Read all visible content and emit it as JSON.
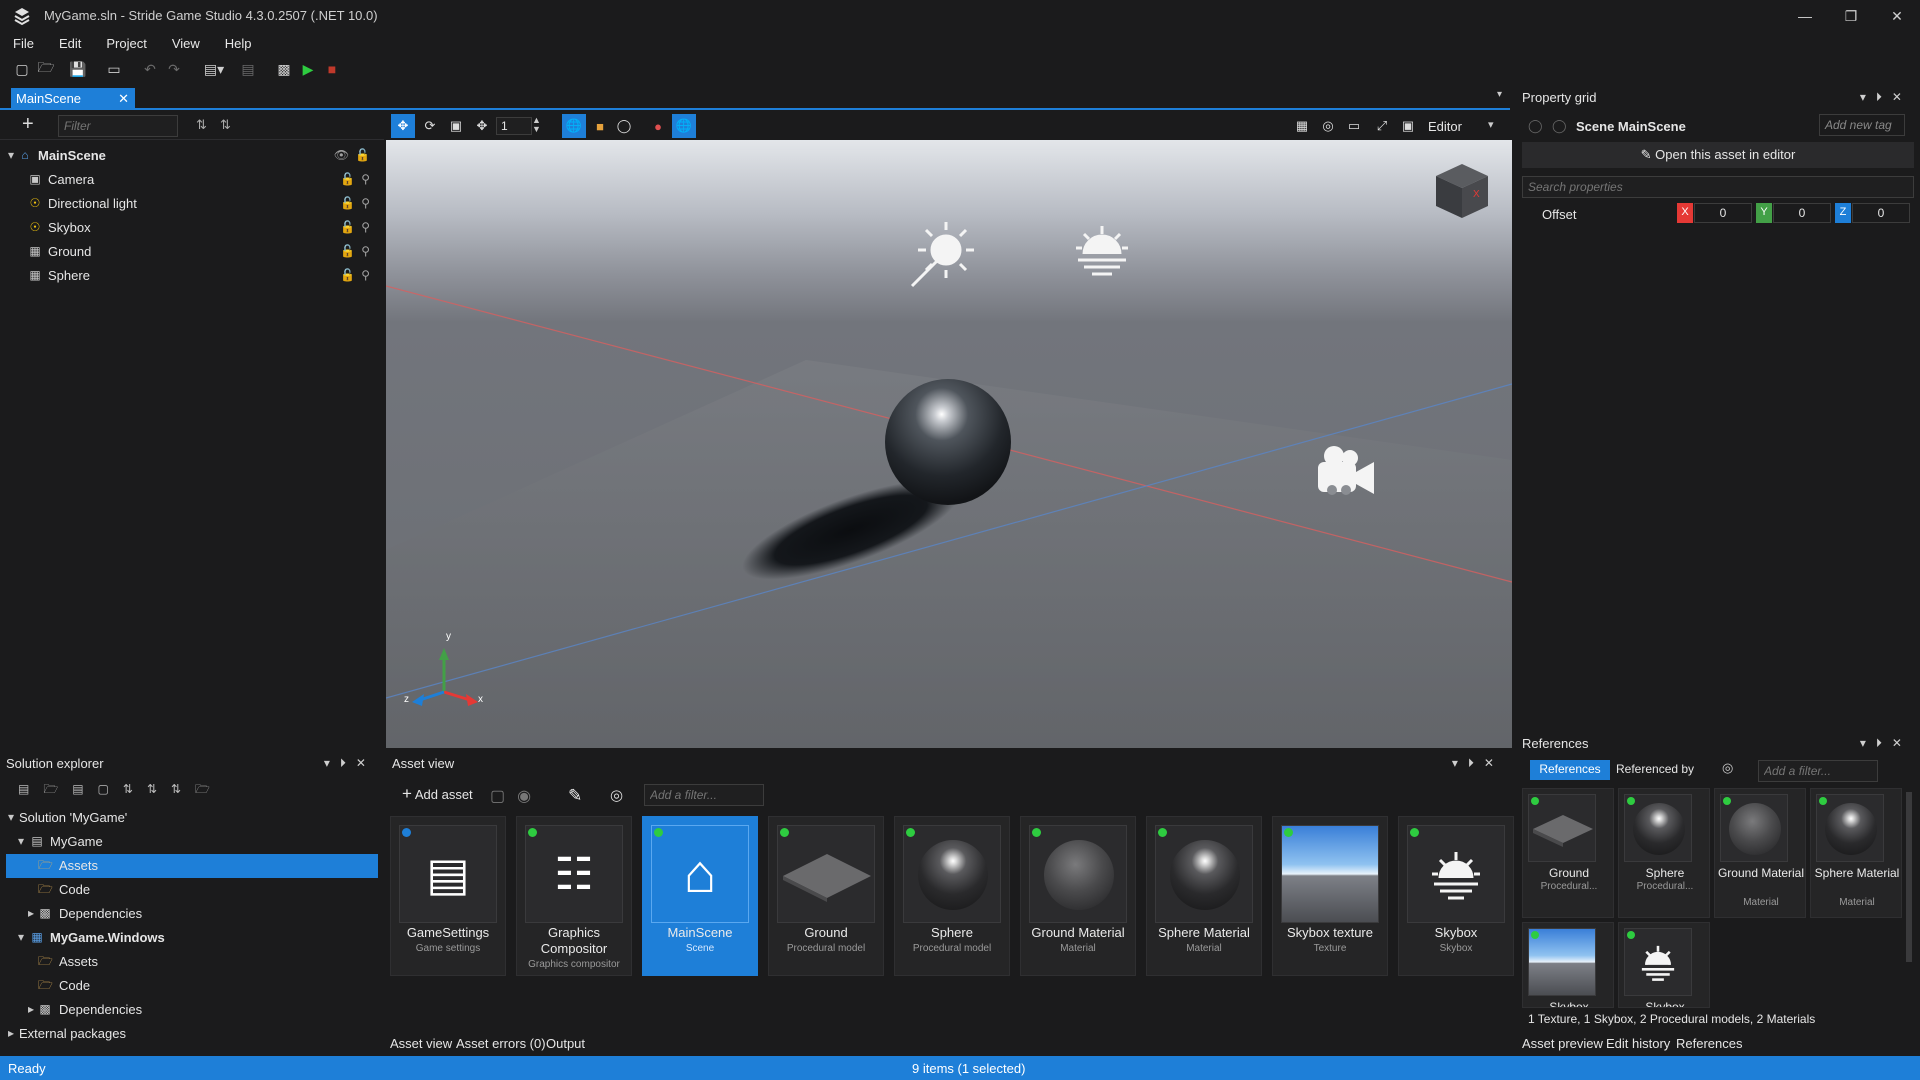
{
  "app": {
    "title": "MyGame.sln - Stride Game Studio 4.3.0.2507 (.NET 10.0)"
  },
  "menu": [
    "File",
    "Edit",
    "Project",
    "View",
    "Help"
  ],
  "document": {
    "tab": "MainScene"
  },
  "scene_tree": {
    "filter_placeholder": "Filter",
    "root": "MainScene",
    "entities": [
      "Camera",
      "Directional light",
      "Skybox",
      "Ground",
      "Sphere"
    ]
  },
  "viewport_toolbar": {
    "snap_value": "1",
    "mode": "Editor"
  },
  "gizmo": {
    "x": "x",
    "y": "y",
    "z": "z",
    "cube_x": "X"
  },
  "property_grid": {
    "title": "Property grid",
    "scene_label": "Scene MainScene",
    "add_tag": "Add new tag",
    "open_button": "Open this asset in editor",
    "search_placeholder": "Search properties",
    "offset": {
      "label": "Offset",
      "x_label": "X",
      "x": "0",
      "y_label": "Y",
      "y": "0",
      "z_label": "Z",
      "z": "0"
    }
  },
  "solution_explorer": {
    "title": "Solution explorer",
    "items": [
      {
        "label": "Solution 'MyGame'"
      },
      {
        "label": "MyGame"
      },
      {
        "label": "Assets"
      },
      {
        "label": "Code"
      },
      {
        "label": "Dependencies"
      },
      {
        "label": "MyGame.Windows"
      },
      {
        "label": "Assets"
      },
      {
        "label": "Code"
      },
      {
        "label": "Dependencies"
      },
      {
        "label": "External packages"
      }
    ]
  },
  "asset_view": {
    "title": "Asset view",
    "add_asset": "Add asset",
    "filter_placeholder": "Add a filter...",
    "assets": [
      {
        "name": "GameSettings",
        "type": "Game settings",
        "icon": "game-settings-icon"
      },
      {
        "name": "Graphics Compositor",
        "type": "Graphics compositor",
        "icon": "compositor-icon"
      },
      {
        "name": "MainScene",
        "type": "Scene",
        "icon": "scene-house-icon"
      },
      {
        "name": "Ground",
        "type": "Procedural model",
        "icon": "plane-thumbnail"
      },
      {
        "name": "Sphere",
        "type": "Procedural model",
        "icon": "sphere-thumbnail"
      },
      {
        "name": "Ground Material",
        "type": "Material",
        "icon": "material-thumbnail"
      },
      {
        "name": "Sphere Material",
        "type": "Material",
        "icon": "material-thumbnail"
      },
      {
        "name": "Skybox texture",
        "type": "Texture",
        "icon": "sky-texture-thumbnail"
      },
      {
        "name": "Skybox",
        "type": "Skybox",
        "icon": "skybox-icon"
      }
    ],
    "bottom_tabs": [
      "Asset view",
      "Asset errors (0)",
      "Output"
    ]
  },
  "references": {
    "title": "References",
    "tab_references": "References",
    "tab_referenced_by": "Referenced by",
    "filter_placeholder": "Add a filter...",
    "items": [
      {
        "name": "Ground",
        "type": "Procedural..."
      },
      {
        "name": "Sphere",
        "type": "Procedural..."
      },
      {
        "name": "Ground Material",
        "type": "Material"
      },
      {
        "name": "Sphere Material",
        "type": "Material"
      },
      {
        "name": "Skybox",
        "type": ""
      },
      {
        "name": "Skybox",
        "type": ""
      }
    ],
    "summary": "1 Texture, 1 Skybox, 2 Procedural models, 2 Materials",
    "bottom_tabs": [
      "Asset preview",
      "Edit history",
      "References"
    ]
  },
  "status": {
    "left": "Ready",
    "center": "9 items (1 selected)"
  },
  "colors": {
    "accent": "#1e7fd8",
    "x_axis": "#e53935",
    "y_axis": "#43a047",
    "z_axis": "#1e7fd8",
    "asset_dot": "#2ecc40"
  }
}
